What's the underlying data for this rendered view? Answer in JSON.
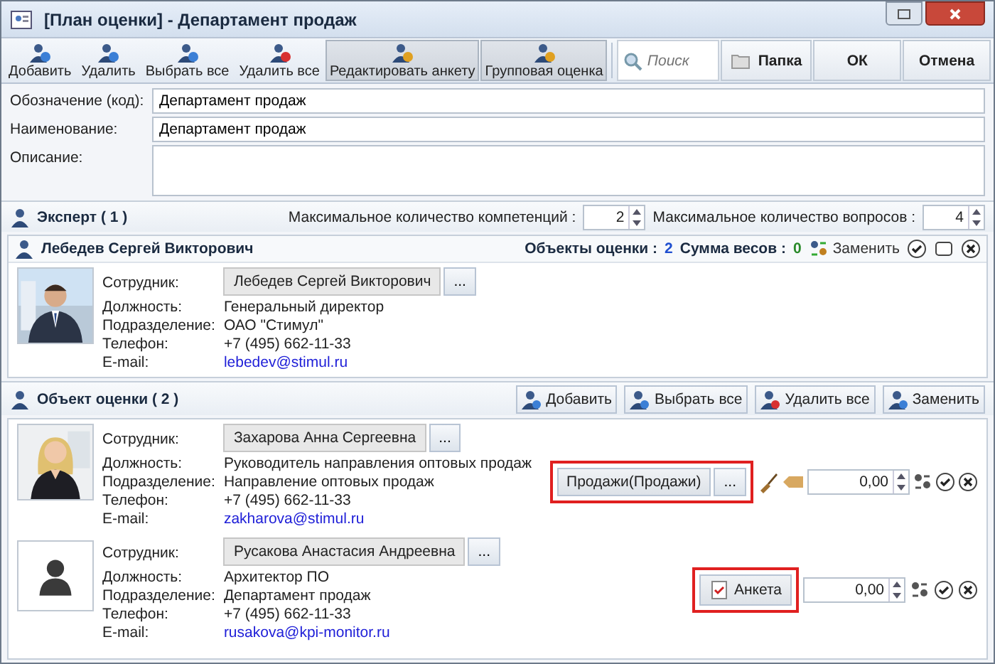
{
  "window": {
    "title": "[План оценки] - Департамент продаж"
  },
  "toolbar": {
    "buttons": [
      {
        "label": "Добавить",
        "pressed": false
      },
      {
        "label": "Удалить",
        "pressed": false
      },
      {
        "label": "Выбрать все",
        "pressed": false
      },
      {
        "label": "Удалить все",
        "pressed": false
      },
      {
        "label": "Редактировать анкету",
        "pressed": true
      },
      {
        "label": "Групповая оценка",
        "pressed": true
      }
    ],
    "search": {
      "placeholder": "Поиск"
    },
    "actions": [
      "Папка",
      "ОК",
      "Отмена"
    ]
  },
  "form": [
    {
      "label": "Обозначение (код):",
      "value": "Департамент продаж",
      "kind": "input"
    },
    {
      "label": "Наименование:",
      "value": "Департамент продаж",
      "kind": "input"
    },
    {
      "label": "Описание:",
      "kind": "textarea"
    }
  ],
  "expert_section": {
    "title": "Эксперт ( 1 )",
    "max_competencies": {
      "label": "Максимальное количество компетенций :",
      "value": "2"
    },
    "max_questions": {
      "label": "Максимальное количество вопросов :",
      "value": "4"
    },
    "expert": {
      "name": "Лебедев Сергей Викторович",
      "objects_label": "Объекты оценки :",
      "objects_count": "2",
      "weights_label": "Сумма весов :",
      "weights_sum": "0",
      "replace": "Заменить",
      "fields": [
        {
          "label": "Сотрудник:",
          "value": "Лебедев Сергей Викторович",
          "kind": "picker",
          "button": "..."
        },
        {
          "label": "Должность:",
          "value": "Генеральный директор",
          "kind": "text"
        },
        {
          "label": "Подразделение:",
          "value": "ОАО \"Стимул\"",
          "kind": "text"
        },
        {
          "label": "Телефон:",
          "value": "+7 (495) 662-11-33",
          "kind": "text"
        },
        {
          "label": "E-mail:",
          "value": "lebedev@stimul.ru",
          "kind": "link"
        }
      ]
    }
  },
  "objects_section": {
    "title": "Объект оценки ( 2 )",
    "buttons": [
      "Добавить",
      "Выбрать все",
      "Удалить все",
      "Заменить"
    ],
    "objects": [
      {
        "kind": "picture",
        "fields": [
          {
            "label": "Сотрудник:",
            "value": "Захарова Анна Сергеевна",
            "kind": "picker",
            "button": "..."
          },
          {
            "label": "Должность:",
            "value": "Руководитель направления оптовых продаж",
            "kind": "text"
          },
          {
            "label": "Подразделение:",
            "value": "Направление оптовых продаж",
            "kind": "text"
          },
          {
            "label": "Телефон:",
            "value": "+7 (495) 662-11-33",
            "kind": "text"
          },
          {
            "label": "E-mail:",
            "value": "zakharova@stimul.ru",
            "kind": "link"
          }
        ],
        "assessment": {
          "kind": "competency",
          "label": "Продажи(Продажи)",
          "button": "...",
          "weight": "0,00",
          "highlighted": true
        }
      },
      {
        "kind": "silhouette",
        "fields": [
          {
            "label": "Сотрудник:",
            "value": "Русакова Анастасия Андреевна",
            "kind": "picker",
            "button": "..."
          },
          {
            "label": "Должность:",
            "value": "Архитектор ПО",
            "kind": "text"
          },
          {
            "label": "Подразделение:",
            "value": "Департамент продаж",
            "kind": "text"
          },
          {
            "label": "Телефон:",
            "value": "+7 (495) 662-11-33",
            "kind": "text"
          },
          {
            "label": "E-mail:",
            "value": "rusakova@kpi-monitor.ru",
            "kind": "link"
          }
        ],
        "assessment": {
          "kind": "questionnaire",
          "label": "Анкета",
          "weight": "0,00",
          "highlighted": true
        }
      }
    ]
  }
}
